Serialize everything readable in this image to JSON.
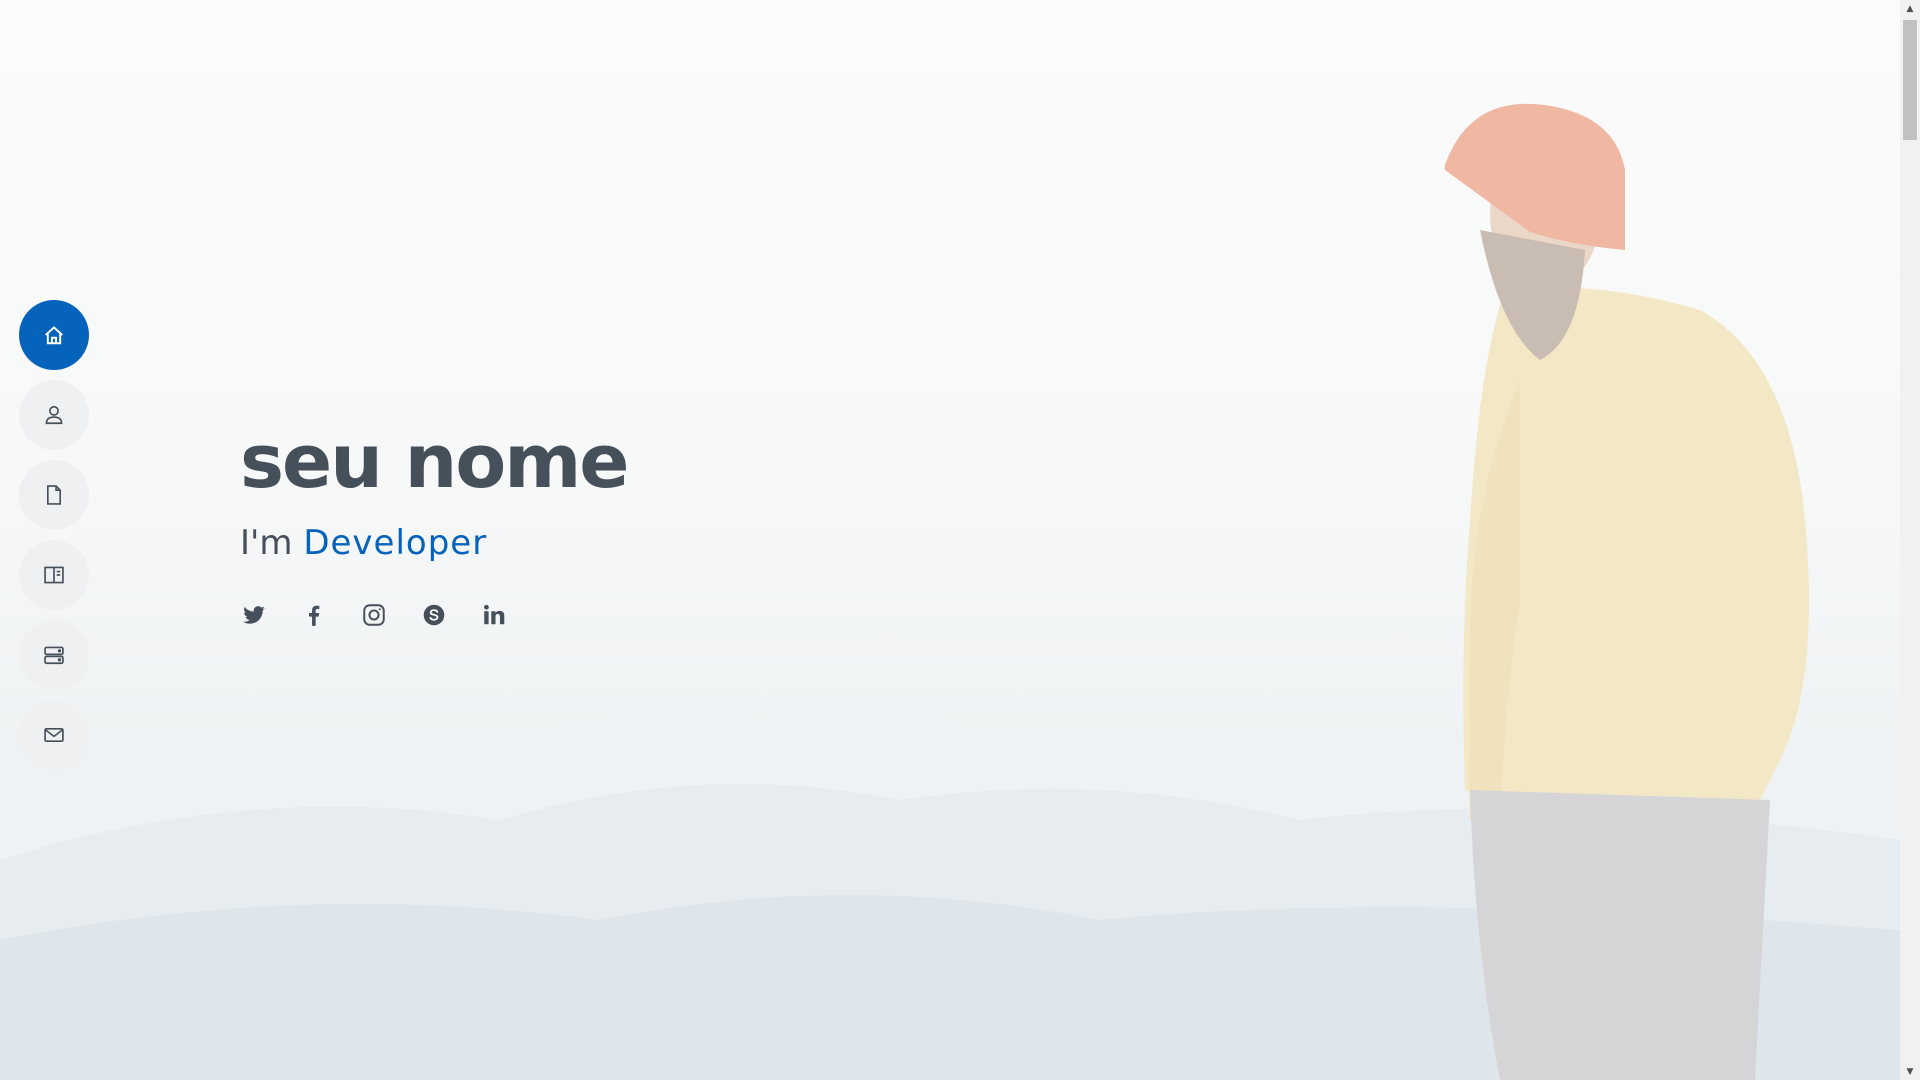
{
  "hero": {
    "name": "seu nome",
    "subtitle_prefix": "I'm",
    "subtitle_typed": "Developer"
  },
  "nav": {
    "items": [
      {
        "icon": "home-icon",
        "active": true
      },
      {
        "icon": "person-icon",
        "active": false
      },
      {
        "icon": "file-icon",
        "active": false
      },
      {
        "icon": "book-half-icon",
        "active": false
      },
      {
        "icon": "server-icon",
        "active": false
      },
      {
        "icon": "envelope-icon",
        "active": false
      }
    ]
  },
  "social": [
    "twitter-icon",
    "facebook-icon",
    "instagram-icon",
    "skype-icon",
    "linkedin-icon"
  ],
  "colors": {
    "accent": "#0563bb",
    "text": "#45505b",
    "nav_bg": "#eff0f1"
  }
}
